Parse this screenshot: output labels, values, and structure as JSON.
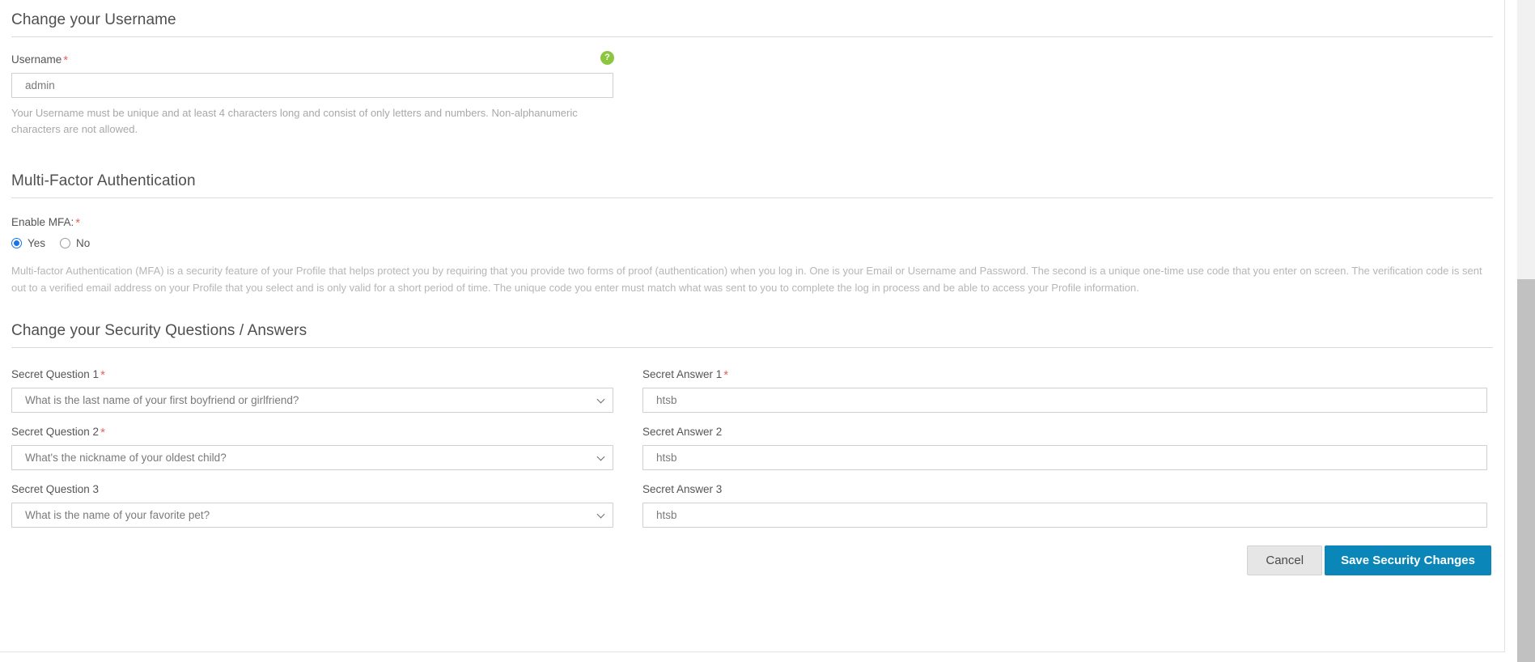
{
  "username_section": {
    "heading": "Change your Username",
    "label": "Username",
    "required_mark": "*",
    "help_icon": "question-mark-help-icon",
    "help_glyph": "?",
    "value": "admin",
    "placeholder": "admin",
    "helper_text": "Your Username must be unique and at least 4 characters long and consist of only letters and numbers. Non-alphanumeric characters are not allowed."
  },
  "mfa_section": {
    "heading": "Multi-Factor Authentication",
    "label": "Enable MFA:",
    "required_mark": "*",
    "options": [
      {
        "label": "Yes",
        "selected": true
      },
      {
        "label": "No",
        "selected": false
      }
    ],
    "description": "Multi-factor Authentication (MFA) is a security feature of your Profile that helps protect you by requiring that you provide two forms of  proof (authentication) when you log in. One is your Email or Username and Password. The second is a unique one-time use code that you enter on screen. The verification code is sent out to a verified email address on your Profile that you select and is only valid for a short period of time. The unique code you enter must match what was sent to you to complete the log in process and be able to access your Profile information."
  },
  "security_section": {
    "heading": "Change your Security Questions / Answers",
    "rows": [
      {
        "question_label": "Secret Question 1",
        "question_required": "*",
        "question_value": "What is the last name of your first boyfriend or girlfriend?",
        "answer_label": "Secret Answer 1",
        "answer_required": "*",
        "answer_value": "htsb"
      },
      {
        "question_label": "Secret Question 2",
        "question_required": "*",
        "question_value": "What's the nickname of your oldest child?",
        "answer_label": "Secret Answer 2",
        "answer_required": "",
        "answer_value": "htsb"
      },
      {
        "question_label": "Secret Question 3",
        "question_required": "",
        "question_value": "What is the name of your favorite pet?",
        "answer_label": "Secret Answer 3",
        "answer_required": "",
        "answer_value": "htsb"
      }
    ]
  },
  "actions": {
    "cancel_label": "Cancel",
    "save_label": "Save Security Changes"
  },
  "colors": {
    "accent_blue": "#0b86b8",
    "help_green": "#8cc63e",
    "required_red": "#e2655b",
    "radio_blue": "#1a73e8"
  },
  "scrollbar": {
    "name": "vertical-scrollbar"
  }
}
